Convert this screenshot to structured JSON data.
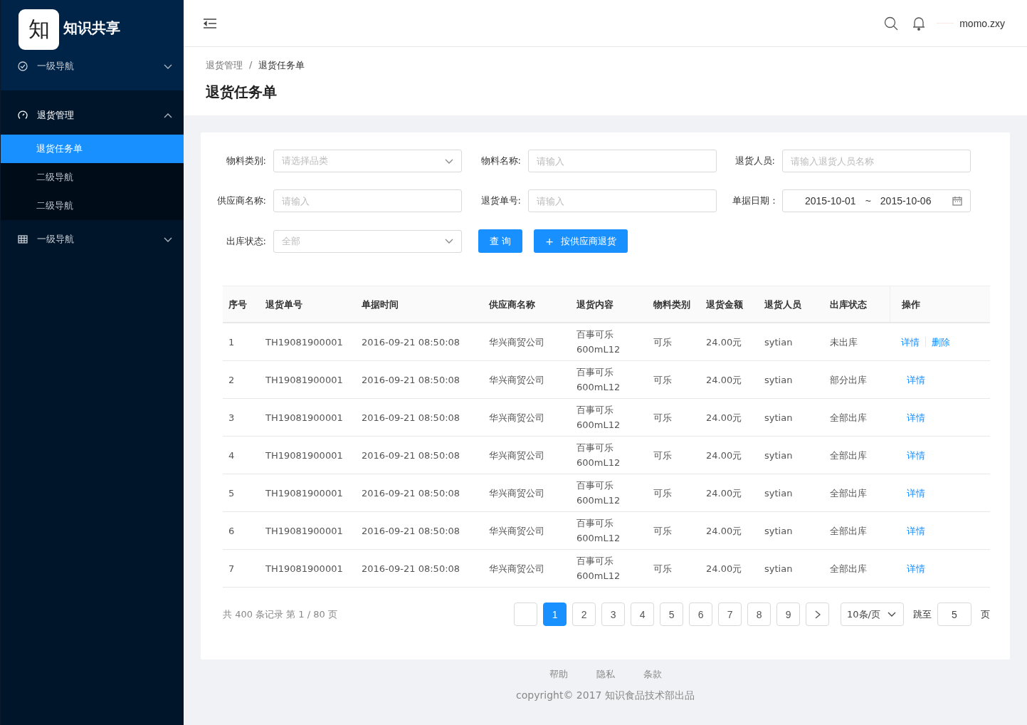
{
  "sidebar": {
    "logo": {
      "mark": "知",
      "title": "知识共享"
    },
    "items": [
      {
        "label": "一级导航",
        "expanded": false
      },
      {
        "label": "退货管理",
        "expanded": true,
        "children": [
          {
            "label": "退货任务单",
            "selected": true
          },
          {
            "label": "二级导航",
            "selected": false
          },
          {
            "label": "二级导航",
            "selected": false
          }
        ]
      },
      {
        "label": "一级导航",
        "expanded": false
      }
    ]
  },
  "header": {
    "user": "momo.zxy"
  },
  "breadcrumb": [
    "退货管理",
    "退货任务单"
  ],
  "breadcrumb_separator": "/",
  "page_title": "退货任务单",
  "filters": [
    {
      "label": "物料类别:",
      "kind": "select",
      "placeholder": "请选择品类"
    },
    {
      "label": "物料名称:",
      "kind": "input",
      "placeholder": "请输入"
    },
    {
      "label": "退货人员:",
      "kind": "input",
      "placeholder": "请输入退货人员名称"
    },
    {
      "label": "供应商名称:",
      "kind": "input",
      "placeholder": "请输入"
    },
    {
      "label": "退货单号:",
      "kind": "input",
      "placeholder": "请输入"
    },
    {
      "label": "单据日期：",
      "kind": "daterange",
      "start": "2015-10-01",
      "separator": "~",
      "end": "2015-10-06"
    },
    {
      "label": "出库状态:",
      "kind": "select",
      "placeholder": "全部"
    }
  ],
  "buttons": [
    {
      "label": "查 询"
    },
    {
      "label": "按供应商退货",
      "prefix": "+"
    }
  ],
  "table": {
    "columns": [
      "序号",
      "退货单号",
      "单据时间",
      "供应商名称",
      "退货内容",
      "物料类别",
      "退货金额",
      "退货人员",
      "出库状态",
      "操作"
    ],
    "rows": [
      {
        "cells": [
          "1",
          "TH19081900001",
          "2016-09-21  08:50:08",
          "华兴商贸公司",
          [
            "百事可乐",
            "600mL12"
          ],
          "可乐",
          "24.00元",
          "sytian",
          "未出库"
        ],
        "actions": [
          "详情",
          "删除"
        ]
      },
      {
        "cells": [
          "2",
          "TH19081900001",
          "2016-09-21  08:50:08",
          "华兴商贸公司",
          [
            "百事可乐",
            "600mL12"
          ],
          "可乐",
          "24.00元",
          "sytian",
          "部分出库"
        ],
        "actions": [
          "详情"
        ]
      },
      {
        "cells": [
          "3",
          "TH19081900001",
          "2016-09-21  08:50:08",
          "华兴商贸公司",
          [
            "百事可乐",
            "600mL12"
          ],
          "可乐",
          "24.00元",
          "sytian",
          "全部出库"
        ],
        "actions": [
          "详情"
        ]
      },
      {
        "cells": [
          "4",
          "TH19081900001",
          "2016-09-21  08:50:08",
          "华兴商贸公司",
          [
            "百事可乐",
            "600mL12"
          ],
          "可乐",
          "24.00元",
          "sytian",
          "全部出库"
        ],
        "actions": [
          "详情"
        ]
      },
      {
        "cells": [
          "5",
          "TH19081900001",
          "2016-09-21  08:50:08",
          "华兴商贸公司",
          [
            "百事可乐",
            "600mL12"
          ],
          "可乐",
          "24.00元",
          "sytian",
          "全部出库"
        ],
        "actions": [
          "详情"
        ]
      },
      {
        "cells": [
          "6",
          "TH19081900001",
          "2016-09-21  08:50:08",
          "华兴商贸公司",
          [
            "百事可乐",
            "600mL12"
          ],
          "可乐",
          "24.00元",
          "sytian",
          "全部出库"
        ],
        "actions": [
          "详情"
        ]
      },
      {
        "cells": [
          "7",
          "TH19081900001",
          "2016-09-21  08:50:08",
          "华兴商贸公司",
          [
            "百事可乐",
            "600mL12"
          ],
          "可乐",
          "24.00元",
          "sytian",
          "全部出库"
        ],
        "actions": [
          "详情"
        ]
      }
    ]
  },
  "pagination": {
    "summary": "共 400 条记录 第 1 / 80 页",
    "pages": [
      {
        "label": "1",
        "selected": true
      },
      {
        "label": "2",
        "selected": false
      },
      {
        "label": "3",
        "selected": false
      },
      {
        "label": "4",
        "selected": false
      },
      {
        "label": "5",
        "selected": false
      },
      {
        "label": "6",
        "selected": false
      },
      {
        "label": "7",
        "selected": false
      },
      {
        "label": "8",
        "selected": false
      },
      {
        "label": "9",
        "selected": false
      }
    ],
    "page_size": "10条/页",
    "jump_label": "跳至",
    "jump_value": "5",
    "jump_unit": "页"
  },
  "footer": {
    "links": [
      "帮助",
      "隐私",
      "条款"
    ],
    "copyright": "copyright© 2017 知识食品技术部出品"
  }
}
